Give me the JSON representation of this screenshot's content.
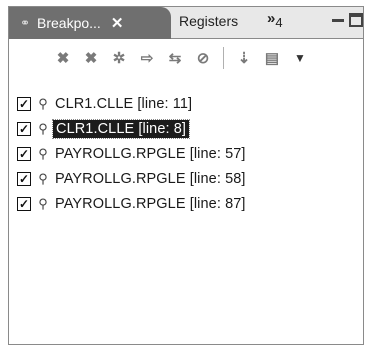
{
  "tabs": {
    "active": {
      "label": "Breakpo...",
      "icon": "breakpoints-view-icon",
      "close": "✕"
    },
    "inactive": {
      "label": "Registers"
    },
    "overflow": {
      "label": "»",
      "count": "4"
    }
  },
  "window_controls": {
    "minimize": "minimize-icon",
    "maximize": "maximize-icon"
  },
  "toolbar": {
    "icons": [
      "remove-breakpoint-icon",
      "remove-all-breakpoints-icon",
      "show-supported-breakpoints-icon",
      "go-to-file-icon",
      "link-with-view-icon",
      "skip-all-breakpoints-icon",
      "expand-all-icon",
      "collapse-all-icon",
      "view-menu-icon"
    ]
  },
  "breakpoints": [
    {
      "label": "CLR1.CLLE [line: 11]",
      "checked": true,
      "selected": false
    },
    {
      "label": "CLR1.CLLE [line: 8]",
      "checked": true,
      "selected": true
    },
    {
      "label": "PAYROLLG.RPGLE [line: 57]",
      "checked": true,
      "selected": false
    },
    {
      "label": "PAYROLLG.RPGLE [line: 58]",
      "checked": true,
      "selected": false
    },
    {
      "label": "PAYROLLG.RPGLE [line: 87]",
      "checked": true,
      "selected": false
    }
  ]
}
